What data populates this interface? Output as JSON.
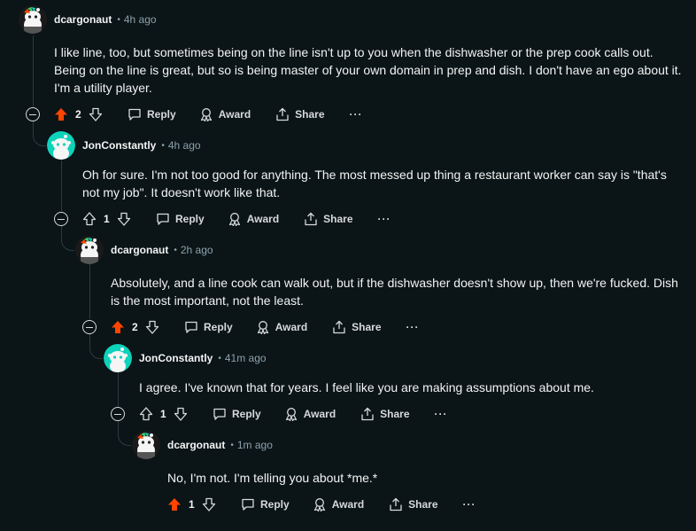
{
  "comments": [
    {
      "username": "dcargonaut",
      "time": "4h ago",
      "body": "I like line, too, but sometimes being on the line isn't up to you when the dishwasher or the prep cook calls out. Being on the line is great, but so is being master of your own domain in prep and dish. I don't have an ego about it. I'm a utility player.",
      "score": "2",
      "upvoted": true,
      "avatar": "snoo-avatar-dark"
    },
    {
      "username": "JonConstantly",
      "time": "4h ago",
      "body": "Oh for sure. I'm not too good for anything. The most messed up thing a restaurant worker can say is \"that's not my job\". It doesn't work like that.",
      "score": "1",
      "upvoted": false,
      "avatar": "snoo-avatar-teal"
    },
    {
      "username": "dcargonaut",
      "time": "2h ago",
      "body": "Absolutely, and a line cook can walk out, but if the dishwasher doesn't show up, then we're fucked. Dish is the most important, not the least.",
      "score": "2",
      "upvoted": true,
      "avatar": "snoo-avatar-dark"
    },
    {
      "username": "JonConstantly",
      "time": "41m ago",
      "body": "I agree. I've known that for years. I feel like you are making assumptions about me.",
      "score": "1",
      "upvoted": false,
      "avatar": "snoo-avatar-teal"
    },
    {
      "username": "dcargonaut",
      "time": "1m ago",
      "body": "No, I'm not. I'm telling you about *me.*",
      "score": "1",
      "upvoted": true,
      "avatar": "snoo-avatar-dark"
    }
  ],
  "actions": {
    "reply": "Reply",
    "award": "Award",
    "share": "Share",
    "more": "···"
  },
  "colors": {
    "background": "#0b1416",
    "upvote": "#ff4500",
    "meta": "#8ba2ad",
    "thread_line": "#2a3c42"
  }
}
